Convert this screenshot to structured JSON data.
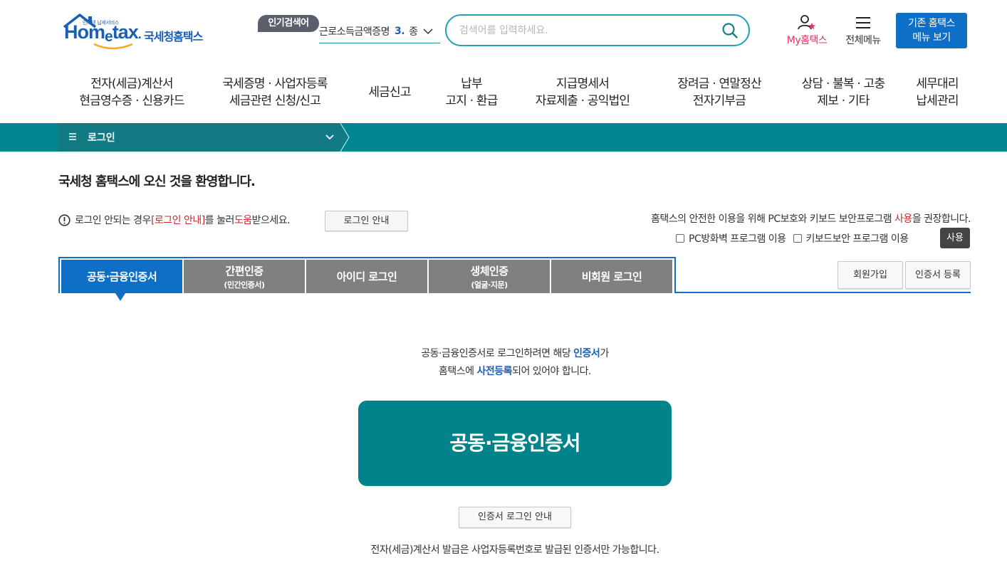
{
  "header": {
    "logo_text": "Hometax",
    "logo_subtext": "인터넷 납세서비스",
    "logo_korean": "국세청홈택스",
    "popular_label": "인기검색어",
    "popular_term": "근로소득금액증명원",
    "popular_rank": "3.",
    "popular_next": "종",
    "search_placeholder": "검색어를 입력하세요.",
    "my_hometax": "My홈택스",
    "all_menu": "전체메뉴",
    "old_menu_line1": "기존 홈택스",
    "old_menu_line2": "메뉴 보기"
  },
  "gnb": [
    {
      "line1": "전자(세금)계산서",
      "line2": "현금영수증 · 신용카드"
    },
    {
      "line1": "국세증명 · 사업자등록",
      "line2": "세금관련 신청/신고"
    },
    {
      "line1": "세금신고",
      "line2": ""
    },
    {
      "line1": "납부",
      "line2": "고지 · 환급"
    },
    {
      "line1": "지급명세서",
      "line2": "자료제출 · 공익법인"
    },
    {
      "line1": "장려금 · 연말정산",
      "line2": "전자기부금"
    },
    {
      "line1": "상담 · 불복 · 고충",
      "line2": "제보 · 기타"
    },
    {
      "line1": "세무대리",
      "line2": "납세관리"
    }
  ],
  "location": {
    "title": "로그인"
  },
  "content": {
    "welcome": "국세청 홈택스에 오신 것을 환영합니다.",
    "notice_prefix": "로그인 안되는 경우 ",
    "notice_link": "[로그인 안내]",
    "notice_mid": "를 눌러 ",
    "notice_help": "도움",
    "notice_suffix": "받으세요.",
    "login_guide_button": "로그인 안내",
    "security_prefix": "홈택스의 안전한 이용을 위해 PC보호와 키보드 보안프로그램 ",
    "security_use": "사용",
    "security_suffix": "을 권장합니다.",
    "check_firewall": "PC방화벽 프로그램 이용",
    "check_keyboard": "키보드보안 프로그램 이용",
    "use_button": "사용"
  },
  "tabs": [
    {
      "label": "공동·금융인증서",
      "sub": ""
    },
    {
      "label": "간편인증",
      "sub": "(민간인증서)"
    },
    {
      "label": "아이디 로그인",
      "sub": ""
    },
    {
      "label": "생체인증",
      "sub": "(얼굴·지문)"
    },
    {
      "label": "비회원 로그인",
      "sub": ""
    }
  ],
  "side_buttons": {
    "join": "회원가입",
    "cert_register": "인증서 등록"
  },
  "cert_panel": {
    "desc1_prefix": "공동·금융인증서로 로그인하려면 해당 ",
    "desc1_blue": "인증서",
    "desc1_suffix": "가",
    "desc2_prefix": "홈택스에 ",
    "desc2_blue": "사전등록",
    "desc2_suffix": "되어 있어야 합니다.",
    "big_button": "공동·금융인증서",
    "guide_button": "인증서 로그인 안내",
    "footnote": "전자(세금)계산서 발급은 사업자등록번호로 발급된 인증서만 가능합니다."
  },
  "colors": {
    "primary_blue": "#0f6fc6",
    "teal": "#00838b",
    "accent_red": "#c62c2c",
    "my_pink": "#e0365f"
  }
}
